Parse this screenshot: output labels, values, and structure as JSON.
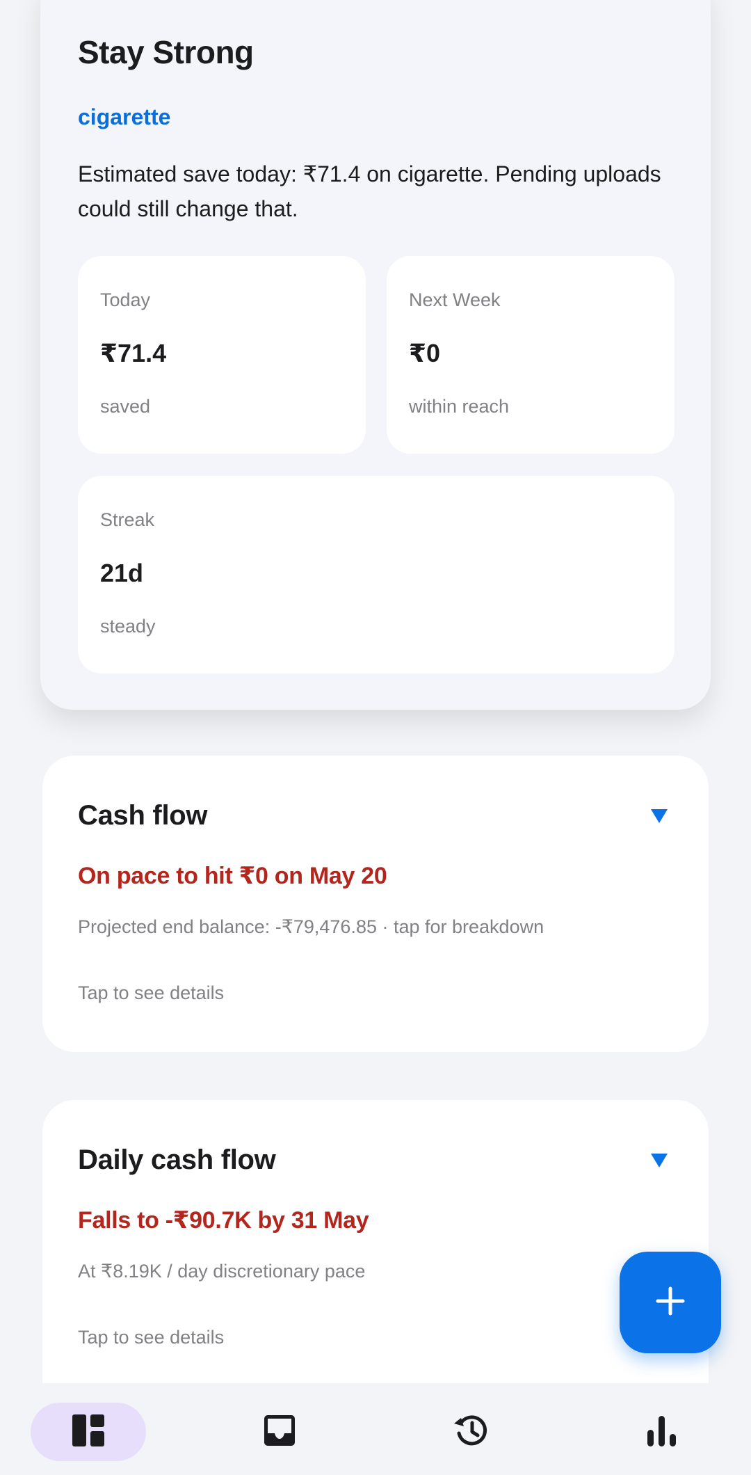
{
  "hero": {
    "title": "Stay Strong",
    "subject": "cigarette",
    "message": "Estimated save today: ₹71.4 on cigarette. Pending uploads could still change that.",
    "stats": [
      {
        "label": "Today",
        "value": "₹71.4",
        "note": "saved"
      },
      {
        "label": "Next Week",
        "value": "₹0",
        "note": "within reach"
      },
      {
        "label": "Streak",
        "value": "21d",
        "note": "steady"
      }
    ]
  },
  "cash_flow": {
    "title": "Cash flow",
    "alert": "On pace to hit ₹0 on May 20",
    "description": "Projected end balance: -₹79,476.85 · tap for breakdown",
    "hint": "Tap to see details"
  },
  "daily_cash_flow": {
    "title": "Daily cash flow",
    "alert": "Falls to -₹90.7K by 31 May",
    "description": "At ₹8.19K / day discretionary pace",
    "hint": "Tap to see details"
  },
  "fab": {
    "icon": "plus-icon"
  },
  "nav": {
    "items": [
      {
        "icon": "dashboard-icon",
        "active": true
      },
      {
        "icon": "inbox-icon",
        "active": false
      },
      {
        "icon": "history-icon",
        "active": false
      },
      {
        "icon": "bar-chart-icon",
        "active": false
      }
    ]
  },
  "colors": {
    "accent": "#0b72e7",
    "link": "#0b6fd6",
    "alert": "#b3261e",
    "nav_active": "#e6defa"
  }
}
